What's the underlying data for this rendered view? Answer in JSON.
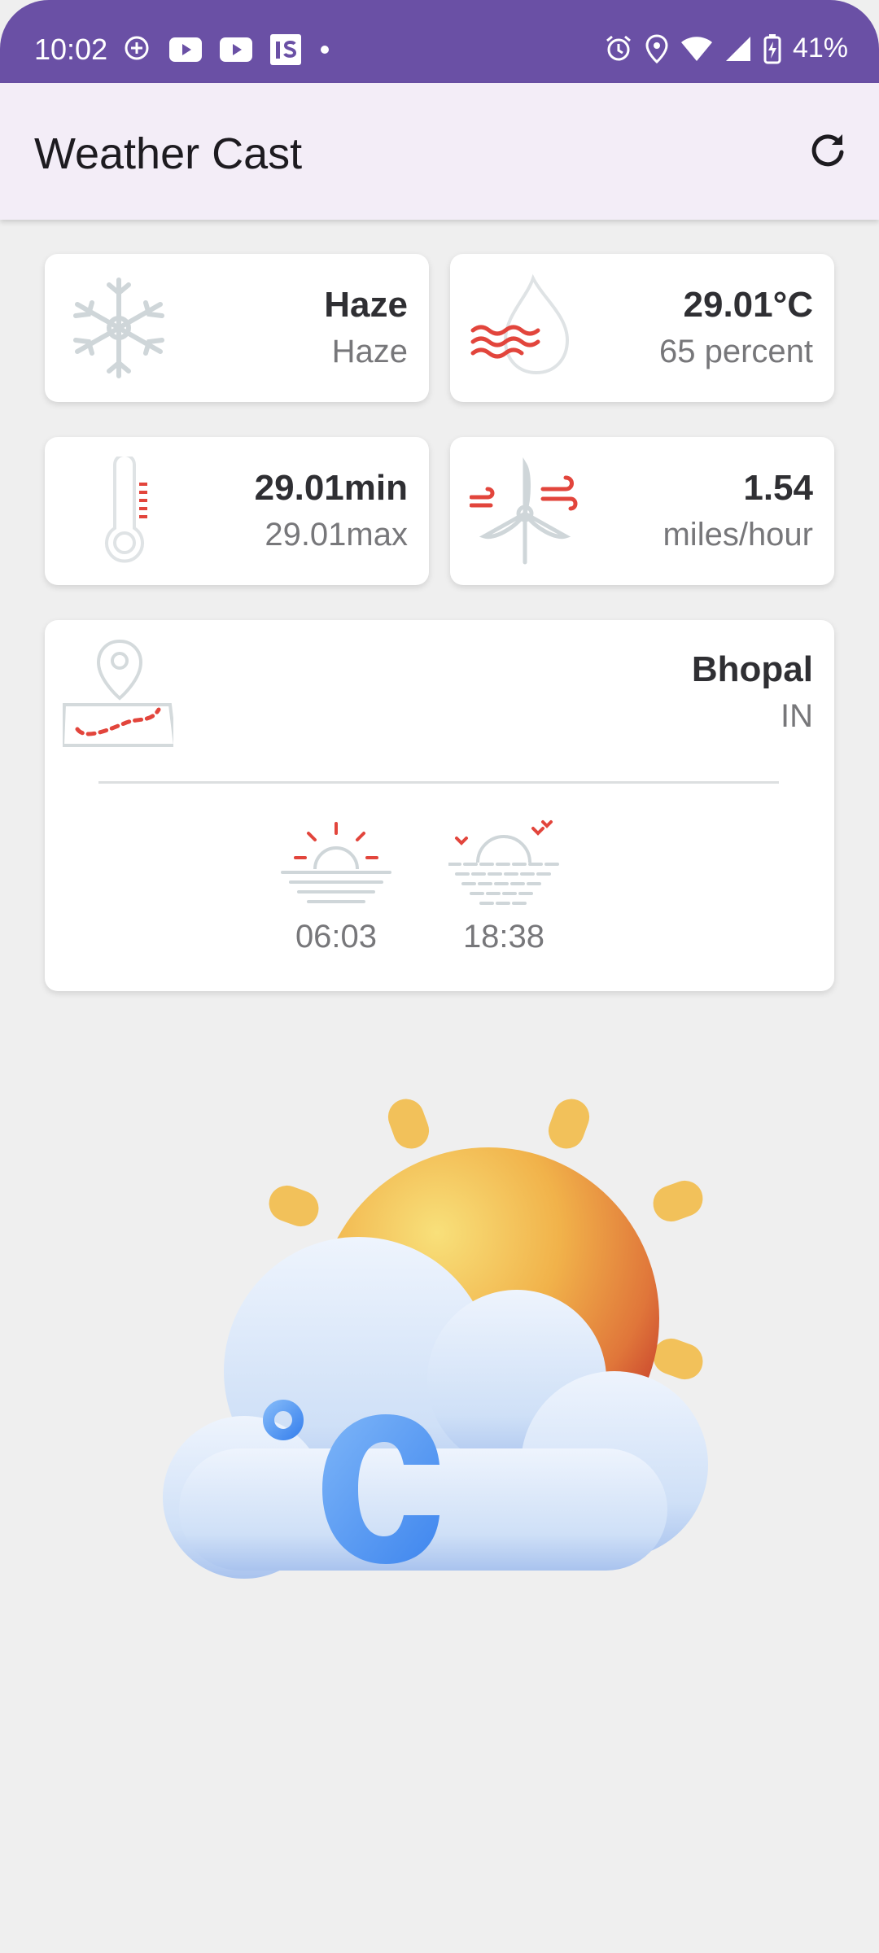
{
  "status_bar": {
    "time": "10:02",
    "battery": "41%",
    "icons_left": [
      "add-location-icon",
      "youtube-icon",
      "youtube-icon",
      "is-app-icon",
      "dot-icon"
    ],
    "icons_right": [
      "alarm-icon",
      "location-icon",
      "wifi-icon",
      "signal-icon",
      "battery-charging-icon"
    ]
  },
  "app_bar": {
    "title": "Weather Cast",
    "refresh_icon": "refresh-icon"
  },
  "cards": {
    "condition": {
      "primary": "Haze",
      "secondary": "Haze",
      "icon": "snowflake-icon"
    },
    "humidity": {
      "primary": "29.01°C",
      "secondary": "65 percent",
      "icon": "humidity-drop-icon"
    },
    "temperature": {
      "primary": "29.01min",
      "secondary": "29.01max",
      "icon": "thermometer-icon"
    },
    "wind": {
      "primary": "1.54",
      "secondary": "miles/hour",
      "icon": "wind-turbine-icon"
    }
  },
  "location": {
    "city": "Bhopal",
    "country": "IN",
    "icon": "map-pin-icon",
    "sunrise": "06:03",
    "sunset": "18:38"
  },
  "colors": {
    "status_bar": "#6a50a5",
    "app_bar": "#f3edf7",
    "background": "#efefef",
    "accent_red": "#e2453c",
    "icon_grey": "#cfd6d9"
  },
  "hero": {
    "icon": "sun-cloud-celsius-icon"
  }
}
